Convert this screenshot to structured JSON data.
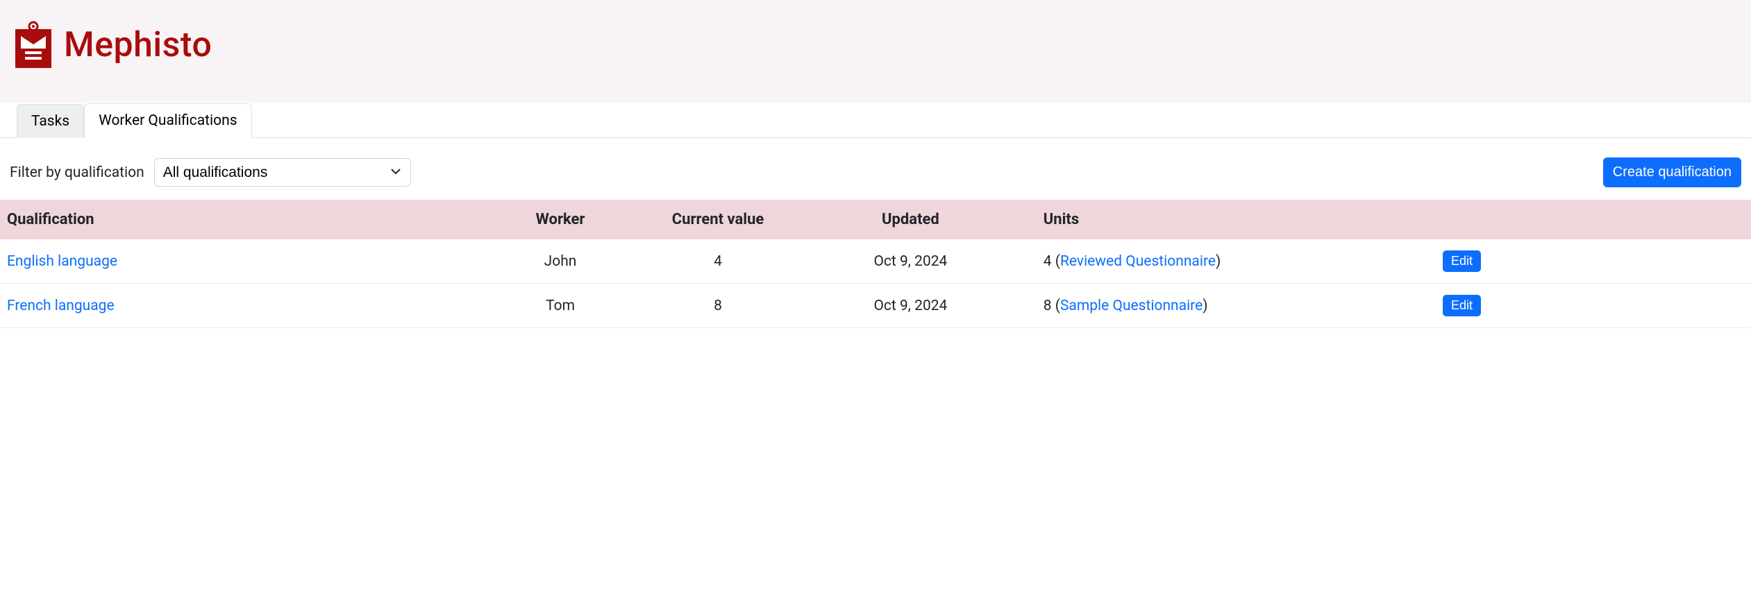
{
  "brand": "Mephisto",
  "tabs": {
    "tasks": "Tasks",
    "worker_qualifications": "Worker Qualifications"
  },
  "filter": {
    "label": "Filter by qualification",
    "selected": "All qualifications"
  },
  "create_button": "Create qualification",
  "table": {
    "headers": {
      "qualification": "Qualification",
      "worker": "Worker",
      "current_value": "Current value",
      "updated": "Updated",
      "units": "Units"
    },
    "rows": [
      {
        "qualification": "English language",
        "worker": "John",
        "value": "4",
        "updated": "Oct 9, 2024",
        "units_count": "4",
        "units_link": "Reviewed Questionnaire",
        "edit": "Edit"
      },
      {
        "qualification": "French language",
        "worker": "Tom",
        "value": "8",
        "updated": "Oct 9, 2024",
        "units_count": "8",
        "units_link": "Sample Questionnaire",
        "edit": "Edit"
      }
    ]
  }
}
